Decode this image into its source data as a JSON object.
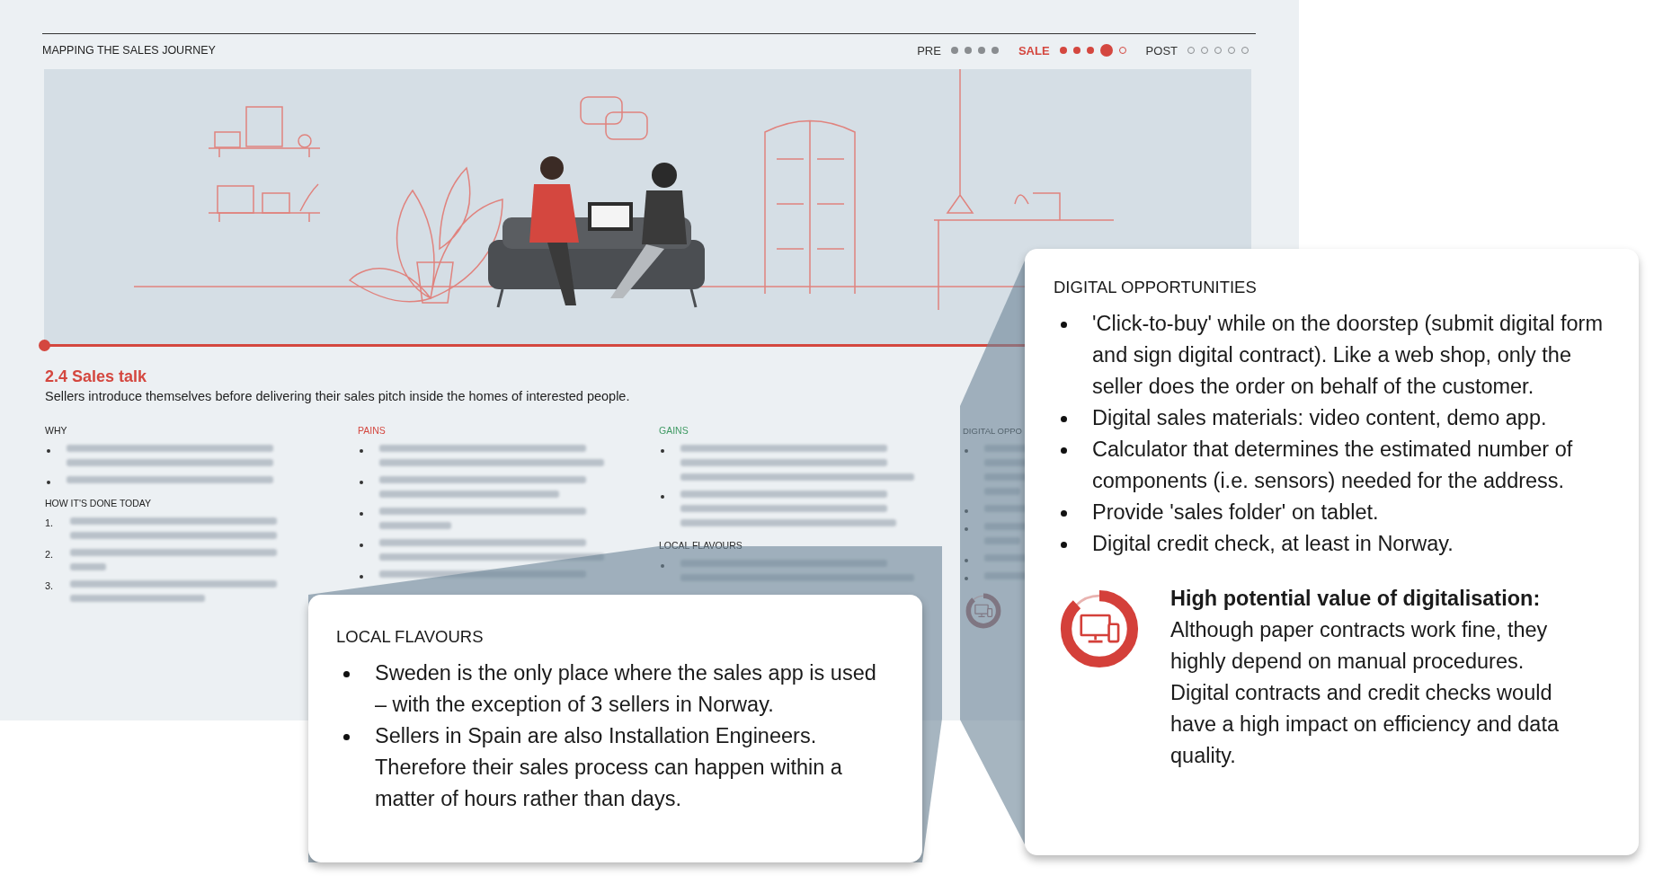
{
  "header": {
    "title": "MAPPING THE SALES JOURNEY",
    "stages": [
      {
        "label": "PRE",
        "active": false,
        "steps": [
          {
            "done": true,
            "current": false
          },
          {
            "done": true,
            "current": false
          },
          {
            "done": true,
            "current": false
          },
          {
            "done": true,
            "current": false
          }
        ]
      },
      {
        "label": "SALE",
        "active": true,
        "steps": [
          {
            "done": true,
            "current": false
          },
          {
            "done": true,
            "current": false
          },
          {
            "done": true,
            "current": false
          },
          {
            "done": true,
            "current": true
          },
          {
            "done": false,
            "current": false
          }
        ]
      },
      {
        "label": "POST",
        "active": false,
        "steps": [
          {
            "done": false,
            "current": false
          },
          {
            "done": false,
            "current": false
          },
          {
            "done": false,
            "current": false
          },
          {
            "done": false,
            "current": false
          },
          {
            "done": false,
            "current": false
          }
        ]
      }
    ]
  },
  "step": {
    "title": "2.4 Sales talk",
    "description": "Sellers introduce themselves before delivering their sales pitch inside the homes of interested people."
  },
  "columns": [
    {
      "blocks": [
        {
          "kind": "bullets",
          "label": "WHY",
          "color": "#222222"
        },
        {
          "kind": "numbered",
          "label": "HOW IT'S DONE TODAY",
          "color": "#222222",
          "numbers": [
            "1.",
            "2.",
            "3."
          ]
        }
      ]
    },
    {
      "blocks": [
        {
          "kind": "bullets",
          "label": "PAINS",
          "color": "#d4473f"
        }
      ]
    },
    {
      "blocks": [
        {
          "kind": "bullets",
          "label": "GAINS",
          "color": "#3f9a63"
        },
        {
          "kind": "bullets",
          "label": "LOCAL FLAVOURS"
        }
      ]
    },
    {
      "blocks": [
        {
          "kind": "bullets",
          "label": "DIGITAL OPPO"
        },
        {
          "kind": "meter",
          "level": 0.88
        }
      ]
    }
  ],
  "callouts": [
    {
      "kind": "plain",
      "title": "LOCAL FLAVOURS",
      "items": [
        "Sweden is the only place where the sales app is used – with the exception of 3 sellers in Norway.",
        "Sellers in Spain are also Installation Engineers. Therefore their sales process can happen within a matter of hours rather than days."
      ]
    },
    {
      "kind": "value",
      "title": "DIGITAL OPPORTUNITIES",
      "items": [
        "'Click-to-buy' while on the doorstep (submit digital form and sign digital contract). Like a web shop, only the seller does the order on behalf of the customer.",
        "Digital sales materials: video content, demo app.",
        "Calculator that determines the estimated number of components (i.e. sensors) needed for the address.",
        "Provide 'sales folder' on tablet.",
        "Digital credit check, at least in Norway."
      ],
      "value": {
        "level": 0.88,
        "title": "High potential value of digitalisation:",
        "text": "Although paper contracts work fine, they highly depend on manual procedures. Digital contracts and credit checks would have a high impact on efficiency and data quality."
      }
    }
  ]
}
